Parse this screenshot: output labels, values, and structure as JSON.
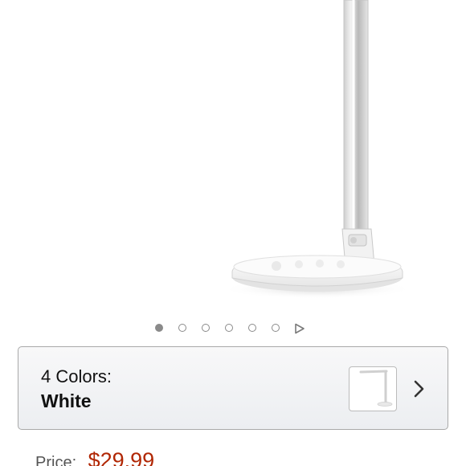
{
  "product_image": {
    "icon": "desk-lamp-image"
  },
  "carousel": {
    "total_images": 6,
    "active_index": 0,
    "play_icon": "play-triangle-icon"
  },
  "color_selector": {
    "count_label": "4 Colors:",
    "selected_label": "White",
    "swatch_icon": "desk-lamp-thumbnail",
    "chevron_icon": "chevron-right-icon"
  },
  "price": {
    "label": "Price:",
    "value": "$29.99",
    "value_color": "#b12704"
  }
}
